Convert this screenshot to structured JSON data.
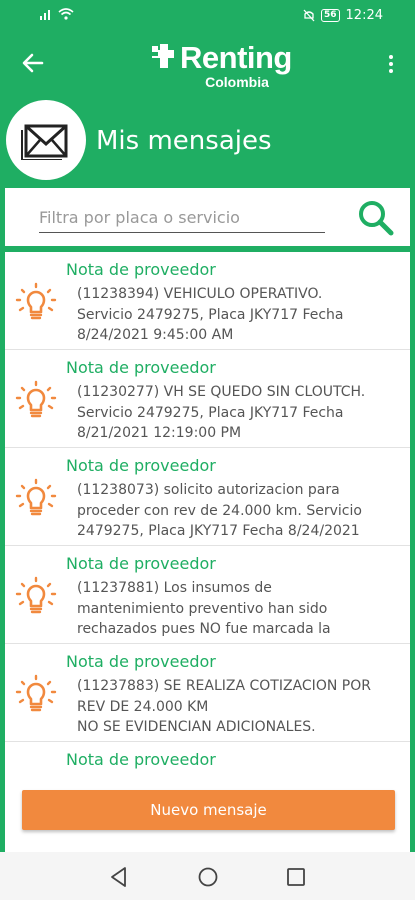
{
  "status_bar": {
    "time": "12:24",
    "battery": "56",
    "icons": [
      "signal-icon",
      "wifi-icon",
      "mute-icon",
      "battery-icon"
    ]
  },
  "app_bar": {
    "logo_title": "Renting",
    "logo_subtitle": "Colombia",
    "back_icon": "arrow-left-icon",
    "menu_icon": "more-vertical-icon"
  },
  "header": {
    "title": "Mis mensajes",
    "icon": "envelope-icon"
  },
  "search": {
    "placeholder": "Filtra por placa o servicio",
    "icon": "search-icon"
  },
  "messages": [
    {
      "title": "Nota de proveedor",
      "body": "(11238394) VEHICULO OPERATIVO.\nServicio 2479275, Placa JKY717 Fecha\n8/24/2021 9:45:00 AM"
    },
    {
      "title": "Nota de proveedor",
      "body": "(11230277) VH SE QUEDO SIN CLOUTCH.\nServicio 2479275, Placa JKY717 Fecha\n8/21/2021 12:19:00 PM"
    },
    {
      "title": "Nota de proveedor",
      "body": "(11238073) solicito autorizacion para\nproceder con rev de 24.000 km. Servicio\n2479275, Placa JKY717 Fecha 8/24/2021"
    },
    {
      "title": "Nota de proveedor",
      "body": "(11237881) Los insumos de\nmantenimiento preventivo han sido\nrechazados pues NO fue marcada la"
    },
    {
      "title": "Nota de proveedor",
      "body": "(11237883) SE REALIZA COTIZACION POR\nREV DE 24.000 KM\nNO SE EVIDENCIAN ADICIONALES."
    },
    {
      "title": "Nota de proveedor",
      "body": ""
    }
  ],
  "actions": {
    "new_message": "Nuevo mensaje"
  },
  "colors": {
    "brand_green": "#1fae63",
    "accent_orange": "#f1893e",
    "text_gray": "#555555"
  },
  "nav": {
    "back": "nav-back-icon",
    "home": "nav-home-icon",
    "recents": "nav-recents-icon"
  }
}
